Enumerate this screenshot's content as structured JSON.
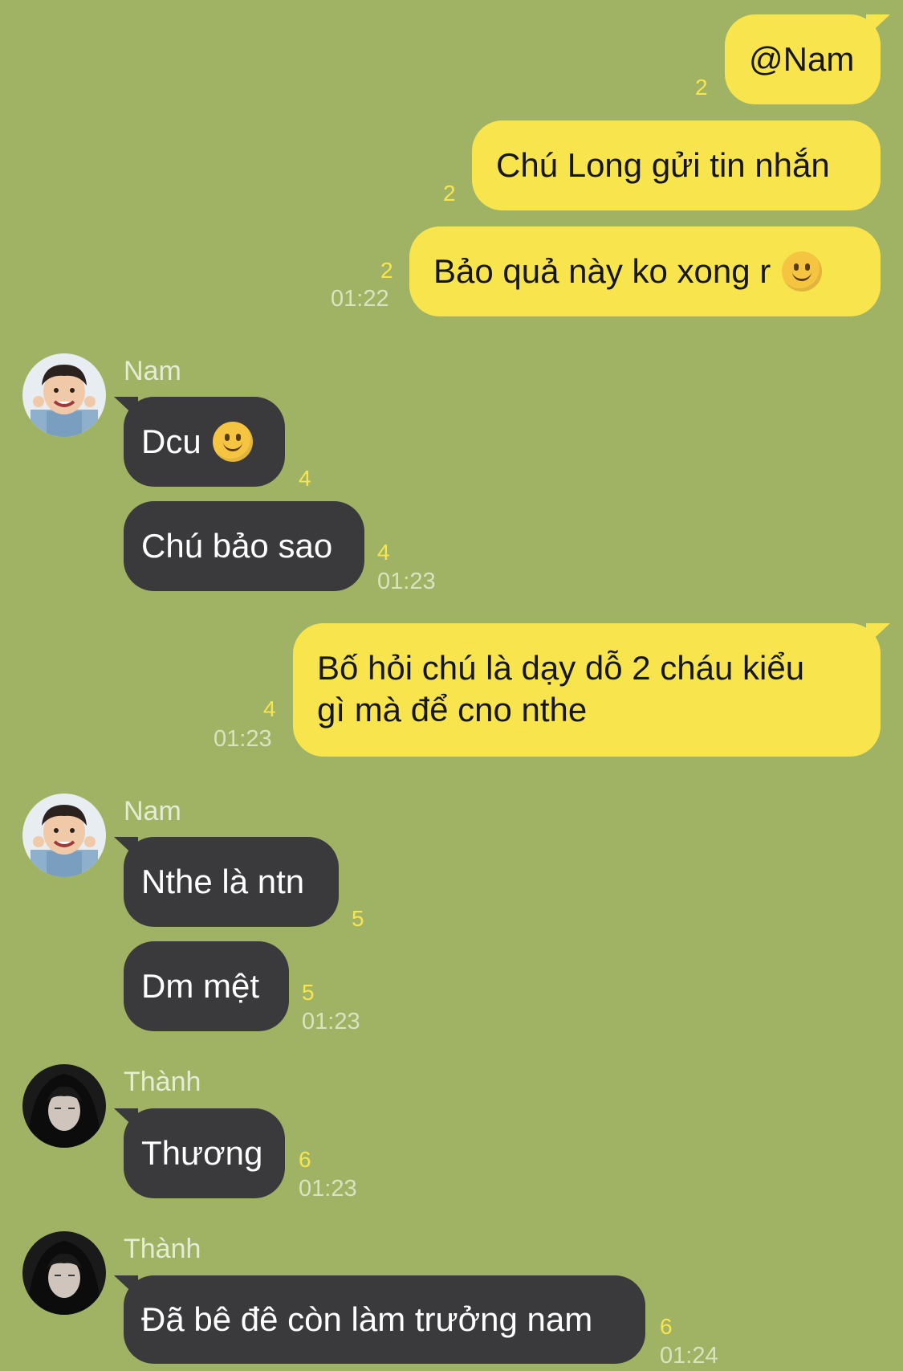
{
  "messages": [
    {
      "text": "@Nam",
      "read": "2"
    },
    {
      "text": "Chú Long gửi tin nhắn",
      "read": "2"
    },
    {
      "text": "Bảo quả này ko xong r",
      "read": "2",
      "time": "01:22",
      "emoji": "slightly-smiling-face"
    },
    {
      "sender": "Nam",
      "text": "Dcu",
      "read": "4",
      "emoji": "slightly-smiling-face"
    },
    {
      "text": "Chú bảo sao",
      "read": "4",
      "time": "01:23"
    },
    {
      "text_line1": "Bố hỏi chú là dạy dỗ 2 cháu kiểu",
      "text_line2": "gì mà để cno nthe",
      "read": "4",
      "time": "01:23"
    },
    {
      "sender": "Nam",
      "text": "Nthe là ntn",
      "read": "5"
    },
    {
      "text": "Dm mệt",
      "read": "5",
      "time": "01:23"
    },
    {
      "sender": "Thành",
      "text": "Thương",
      "read": "6",
      "time": "01:23"
    },
    {
      "sender": "Thành",
      "text": "Đã bê đê còn làm trưởng nam",
      "read": "6",
      "time": "01:24"
    }
  ],
  "colors": {
    "background": "#a0b364",
    "outgoing_bubble": "#f8e54e",
    "incoming_bubble": "#3a3a3c",
    "read_count": "#f8e54e"
  }
}
